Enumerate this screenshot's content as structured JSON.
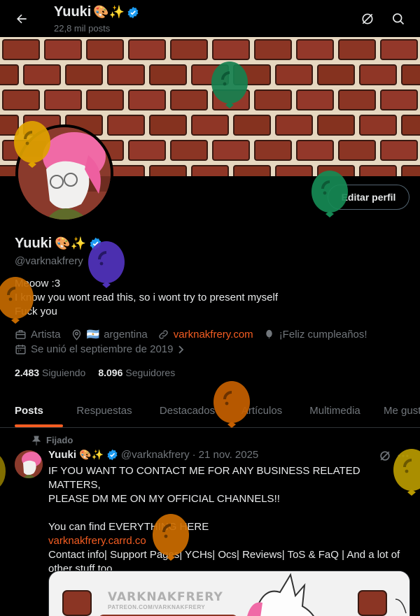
{
  "header": {
    "title": "Yuuki",
    "title_emoji": "🎨✨",
    "posts_count": "22,8 mil posts"
  },
  "profile": {
    "edit_label": "Editar perfil",
    "name": "Yuuki",
    "name_emoji": "🎨✨",
    "handle": "@varknakfrery",
    "bio": [
      "Meoow :3",
      "I know you wont read this, so i wont try to present myself",
      "Fuck you"
    ],
    "category": "Artista",
    "location": "argentina",
    "location_flag": "🇦🇷",
    "website": "varknakfrery.com",
    "birthday": "¡Feliz cumpleaños!",
    "joined": "Se unió el septiembre de 2019",
    "following_count": "2.483",
    "following_label": "Siguiendo",
    "followers_count": "8.096",
    "followers_label": "Seguidores"
  },
  "tabs": [
    {
      "label": "Posts",
      "active": true
    },
    {
      "label": "Respuestas"
    },
    {
      "label": "Destacados"
    },
    {
      "label": "Artículos"
    },
    {
      "label": "Multimedia"
    },
    {
      "label": "Me gusta"
    }
  ],
  "tweet": {
    "pinned_label": "Fijado",
    "name": "Yuuki",
    "name_emoji": "🎨✨",
    "handle": "@varknakfrery",
    "sep": "·",
    "date": "21 nov. 2025",
    "lines": [
      "IF YOU WANT TO CONTACT ME FOR ANY BUSINESS RELATED MATTERS,",
      "PLEASE DM ME ON MY OFFICIAL CHANNELS!!",
      "",
      "You can find EVERYTHING HERE"
    ],
    "link": "varknakfrery.carrd.co",
    "lines2": [
      "Contact info| Support Pages| YCHs| Ocs| Reviews| ToS & FaQ | And a lot of",
      "other stuff too"
    ],
    "media_title": "VARKNAKFRERY",
    "media_sub": "PATREON.COM/VARKNAKFRERY"
  },
  "colors": {
    "accent": "#f45d22",
    "verified": "#1d9bf0",
    "muted": "#71767b",
    "brick": "#8b3524",
    "mortar": "#e6d7c0"
  },
  "icons": [
    "back-arrow-icon",
    "grok-icon",
    "search-icon",
    "briefcase-icon",
    "location-pin-icon",
    "link-icon",
    "balloon-icon",
    "calendar-icon",
    "chevron-right-icon",
    "pin-icon",
    "verified-badge-icon",
    "more-icon"
  ]
}
